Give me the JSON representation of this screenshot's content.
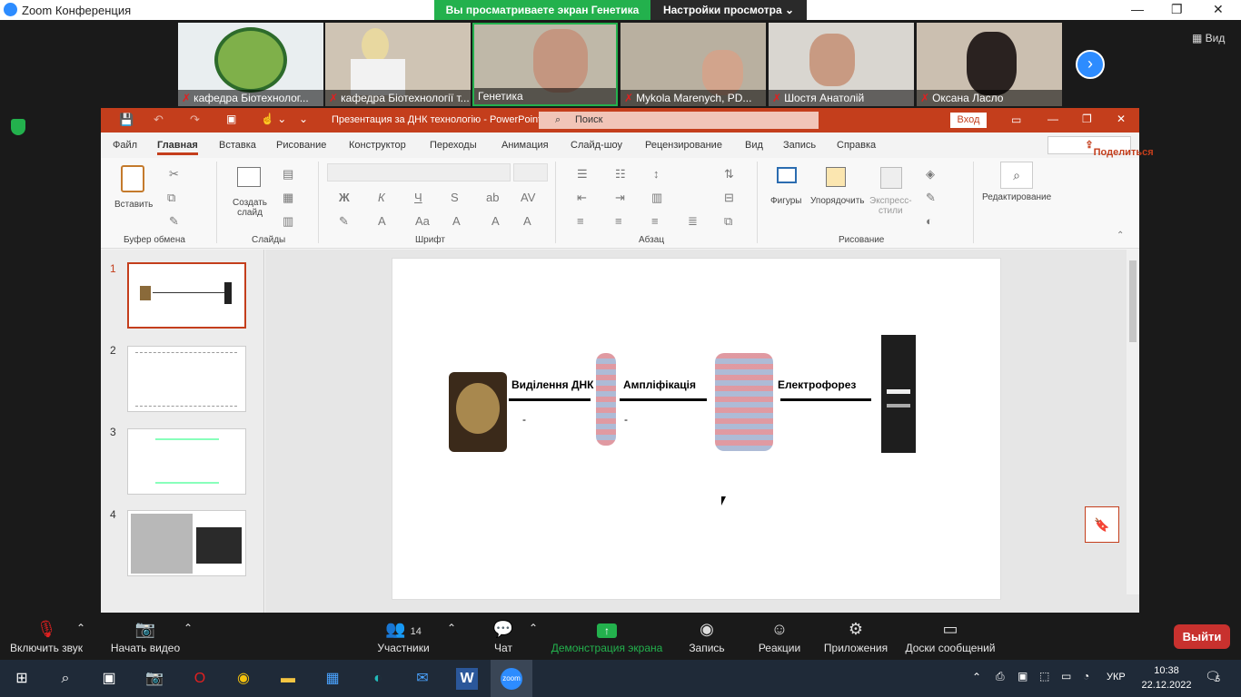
{
  "zoom": {
    "title": "Zoom Конференция",
    "share_banner": "Вы просматриваете экран Генетика",
    "view_settings": "Настройки просмотра",
    "view_label": "Вид",
    "participants": [
      {
        "name": "кафедра Біотехнолог..."
      },
      {
        "name": "кафедра Біотехнології т..."
      },
      {
        "name": "Генетика"
      },
      {
        "name": "Mykola Marenych, PD..."
      },
      {
        "name": "Шостя Анатолій"
      },
      {
        "name": "Оксана Ласло"
      }
    ],
    "toolbar": {
      "mute": "Включить звук",
      "video": "Начать видео",
      "participants": "Участники",
      "participants_count": "14",
      "chat": "Чат",
      "share": "Демонстрация экрана",
      "record": "Запись",
      "reactions": "Реакции",
      "apps": "Приложения",
      "whiteboard": "Доски сообщений",
      "leave": "Выйти"
    }
  },
  "ppt": {
    "filename": "Презентация за ДНК технологію  -  PowerPoint",
    "search_placeholder": "Поиск",
    "login": "Вход",
    "share": "Поделиться",
    "menu": [
      "Файл",
      "Главная",
      "Вставка",
      "Рисование",
      "Конструктор",
      "Переходы",
      "Анимация",
      "Слайд-шоу",
      "Рецензирование",
      "Вид",
      "Запись",
      "Справка"
    ],
    "ribbon": {
      "paste": "Вставить",
      "new_slide_1": "Создать",
      "new_slide_2": "слайд",
      "shapes": "Фигуры",
      "arrange": "Упорядочить",
      "quick_styles_1": "Экспресс-",
      "quick_styles_2": "стили",
      "editing": "Редактирование",
      "groups": {
        "clipboard": "Буфер обмена",
        "slides": "Слайды",
        "font": "Шрифт",
        "paragraph": "Абзац",
        "drawing": "Рисование"
      }
    },
    "slides": [
      "1",
      "2",
      "3",
      "4"
    ],
    "slide_content": {
      "step1": "Виділення ДНК",
      "step2": "Ампліфікація",
      "step3": "Електрофорез",
      "dash1": "-",
      "dash2": "-"
    }
  },
  "taskbar": {
    "lang": "УКР",
    "time": "10:38",
    "date": "22.12.2022",
    "notif": "5"
  }
}
